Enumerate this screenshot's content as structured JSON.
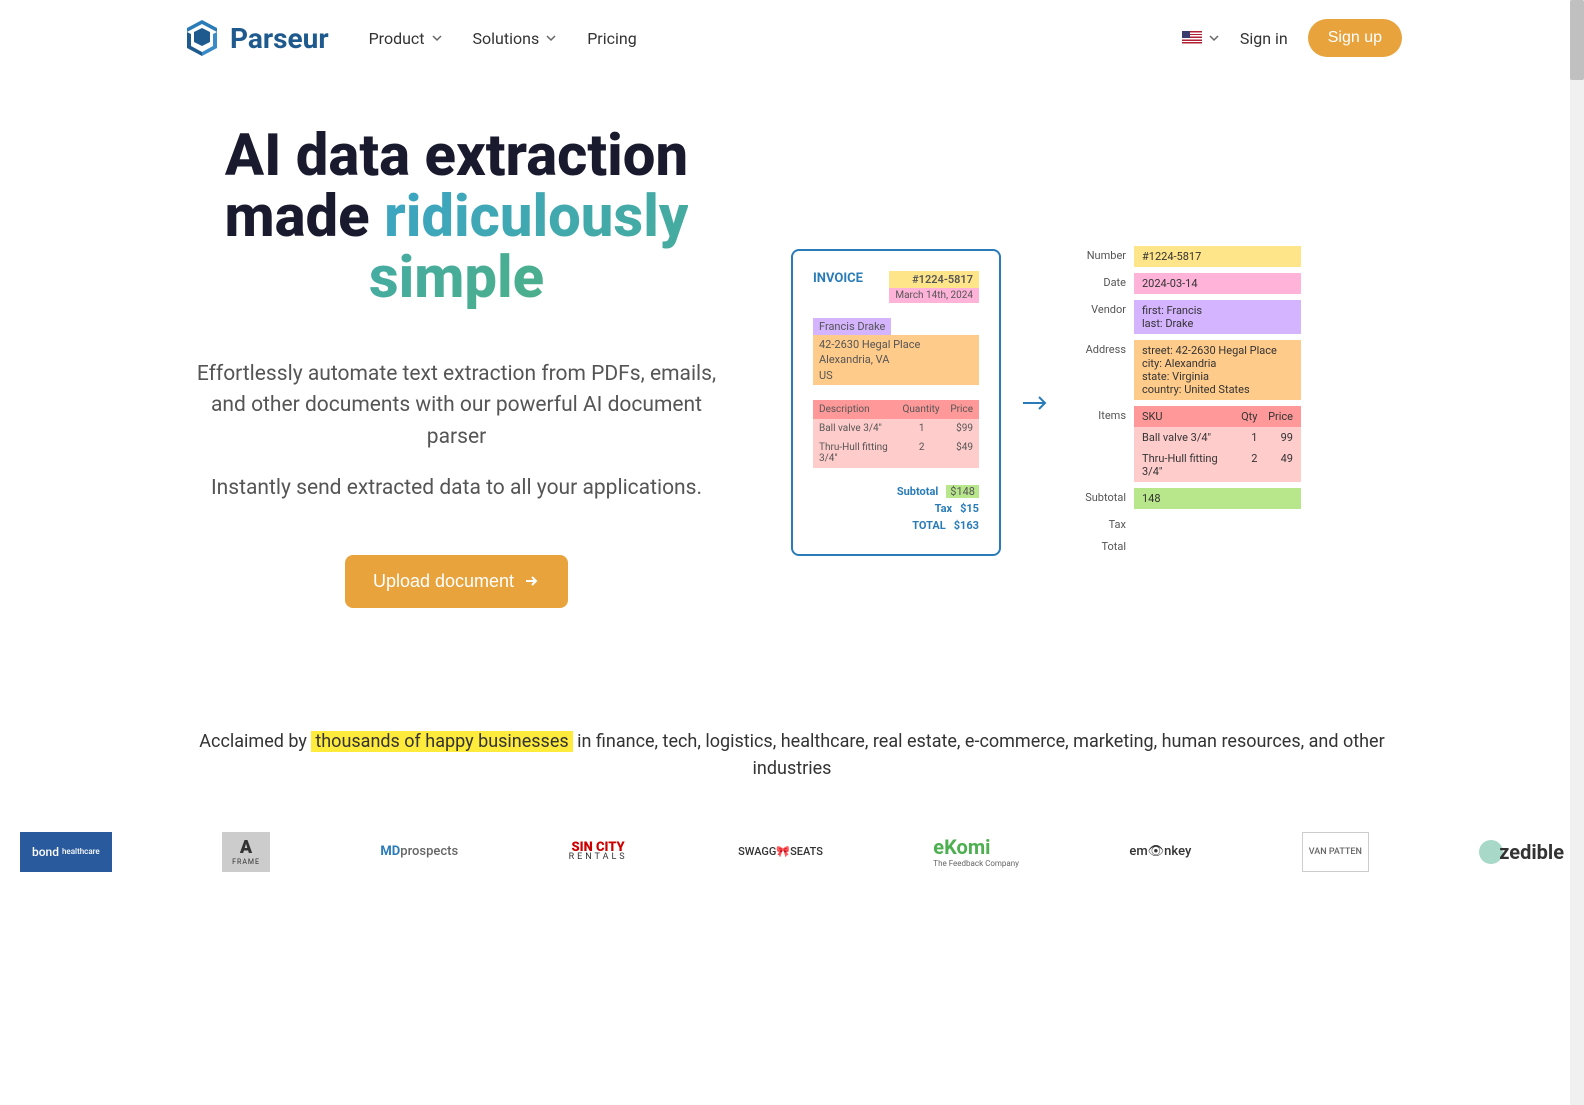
{
  "header": {
    "brand": "Parseur",
    "nav": {
      "product": "Product",
      "solutions": "Solutions",
      "pricing": "Pricing"
    },
    "signin": "Sign in",
    "signup": "Sign up"
  },
  "hero": {
    "title_line1": "AI data extraction made",
    "title_gradient": "ridiculously simple",
    "subtitle1": "Effortlessly automate text extraction from PDFs, emails, and other documents with our powerful AI document parser",
    "subtitle2": "Instantly send extracted data to all your applications.",
    "cta": "Upload document"
  },
  "invoice": {
    "title": "INVOICE",
    "number": "#1224-5817",
    "date": "March 14th, 2024",
    "vendor_name": "Francis Drake",
    "addr_line1": "42-2630 Hegal Place",
    "addr_line2": "Alexandria, VA",
    "addr_line3": "US",
    "headers": {
      "description": "Description",
      "quantity": "Quantity",
      "price": "Price"
    },
    "items": [
      {
        "desc": "Ball valve 3/4\"",
        "qty": "1",
        "price": "$99"
      },
      {
        "desc": "Thru-Hull fitting 3/4\"",
        "qty": "2",
        "price": "$49"
      }
    ],
    "subtotal_label": "Subtotal",
    "subtotal": "$148",
    "tax_label": "Tax",
    "tax": "$15",
    "total_label": "TOTAL",
    "total": "$163"
  },
  "extracted": {
    "labels": {
      "number": "Number",
      "date": "Date",
      "vendor": "Vendor",
      "address": "Address",
      "items": "Items",
      "subtotal": "Subtotal",
      "tax": "Tax",
      "total": "Total"
    },
    "number": "#1224-5817",
    "date": "2024-03-14",
    "vendor_first": "first: Francis",
    "vendor_last": "last: Drake",
    "addr_street": "street: 42-2630 Hegal Place",
    "addr_city": "city: Alexandria",
    "addr_state": "state: Virginia",
    "addr_country": "country: United States",
    "items_header": {
      "sku": "SKU",
      "qty": "Qty",
      "price": "Price"
    },
    "items": [
      {
        "sku": "Ball valve 3/4\"",
        "qty": "1",
        "price": "99"
      },
      {
        "sku": "Thru-Hull fitting 3/4\"",
        "qty": "2",
        "price": "49"
      }
    ],
    "subtotal": "148"
  },
  "acclaimed": {
    "prefix": "Acclaimed by ",
    "highlight": "thousands of happy businesses",
    "suffix": " in finance, tech, logistics, healthcare, real estate, e-commerce, marketing, human resources, and other industries"
  },
  "logos": {
    "bond": "bond",
    "bond_sub": "healthcare",
    "frame": "A",
    "frame_sub": "FRAME",
    "md": "MDprospects",
    "sincity": "SIN CITY",
    "sincity_sub": "RENTALS",
    "swagg": "SWAGG🎀SEATS",
    "ekomi": "eKomi",
    "ekomi_sub": "The Feedback Company",
    "emonkey": "em👁nkey",
    "van": "VAN PATTEN",
    "zedible": "zedible"
  }
}
